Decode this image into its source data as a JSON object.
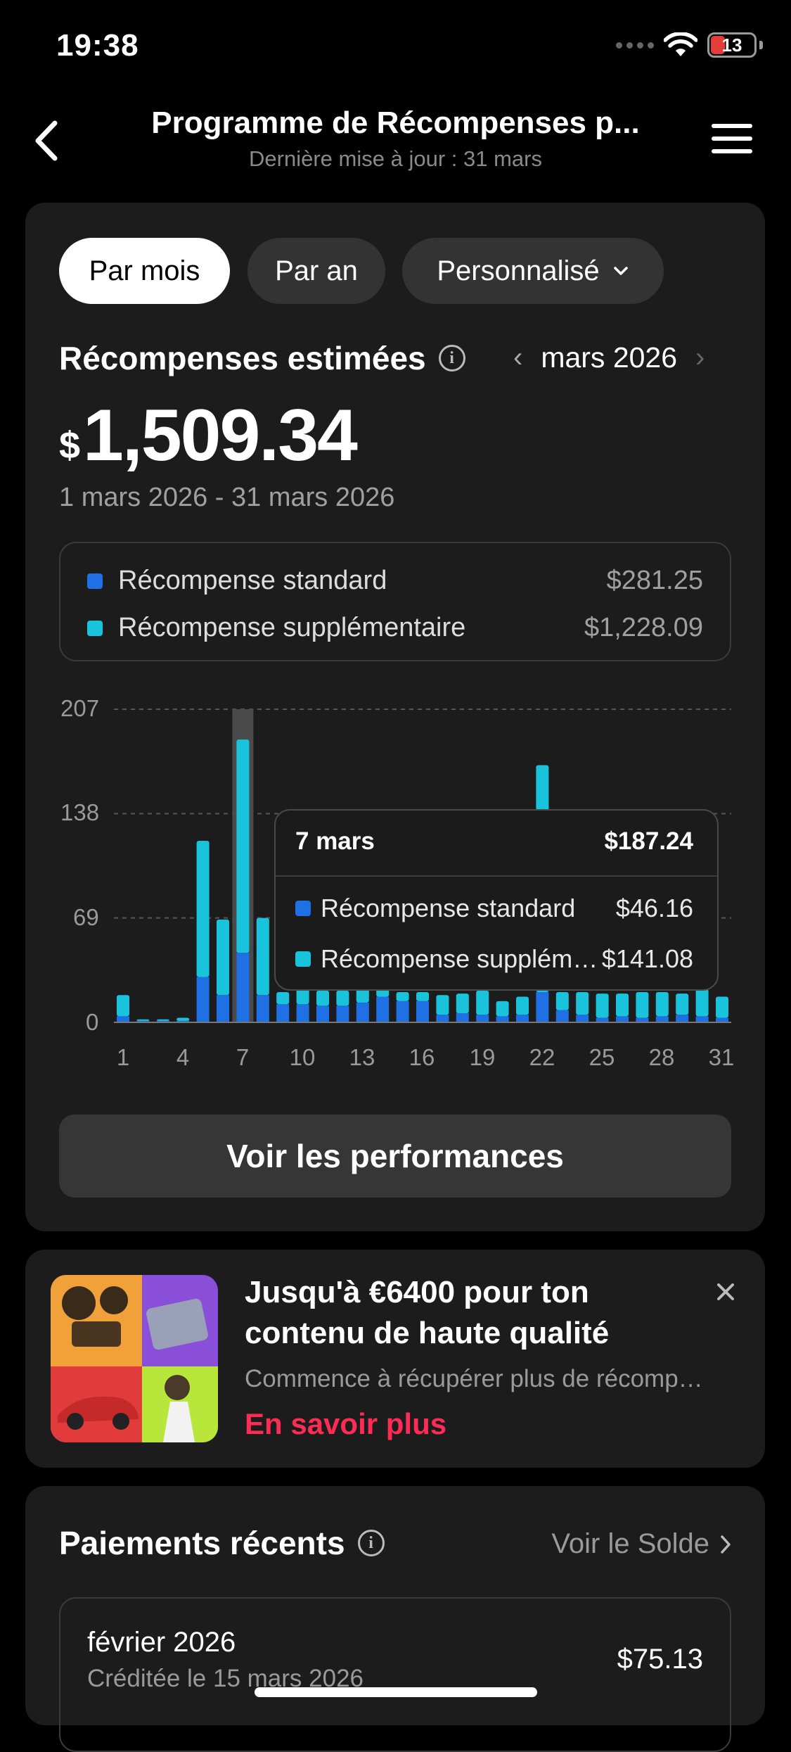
{
  "status_bar": {
    "time": "19:38",
    "battery": "13"
  },
  "header": {
    "title": "Programme de Récompenses p...",
    "subtitle": "Dernière mise à jour : 31 mars"
  },
  "filters": [
    {
      "label": "Par mois",
      "active": true
    },
    {
      "label": "Par an",
      "active": false
    },
    {
      "label": "Personnalisé",
      "active": false
    }
  ],
  "rewards": {
    "title": "Récompenses estimées",
    "month": "mars 2026",
    "currency": "$",
    "amount": "1,509.34",
    "range": "1 mars 2026 - 31 mars 2026",
    "legend": [
      {
        "label": "Récompense standard",
        "value": "$281.25",
        "color": "#1f6fe5"
      },
      {
        "label": "Récompense supplémentaire",
        "value": "$1,228.09",
        "color": "#19c3dc"
      }
    ]
  },
  "chart_data": {
    "type": "bar",
    "stacked": true,
    "x": [
      1,
      2,
      3,
      4,
      5,
      6,
      7,
      8,
      9,
      10,
      11,
      12,
      13,
      14,
      15,
      16,
      17,
      18,
      19,
      20,
      21,
      22,
      23,
      24,
      25,
      26,
      27,
      28,
      29,
      30,
      31
    ],
    "x_ticks": [
      "1",
      "4",
      "7",
      "10",
      "13",
      "16",
      "19",
      "22",
      "25",
      "28",
      "31"
    ],
    "y_ticks": [
      "207",
      "138",
      "69",
      "0"
    ],
    "ylim": [
      0,
      207
    ],
    "highlight_x": 7,
    "grid": true,
    "series": [
      {
        "name": "Récompense standard",
        "color": "#1f6fe5",
        "values": [
          4,
          1,
          1,
          1,
          30,
          18,
          46,
          18,
          12,
          12,
          11,
          11,
          13,
          17,
          14,
          14,
          5,
          6,
          5,
          4,
          5,
          20,
          8,
          5,
          3,
          4,
          3,
          4,
          5,
          4,
          3
        ]
      },
      {
        "name": "Récompense supplémentaire",
        "color": "#19c3dc",
        "values": [
          14,
          1,
          1,
          2,
          90,
          50,
          141,
          51,
          8,
          10,
          10,
          10,
          10,
          5,
          6,
          6,
          13,
          13,
          16,
          10,
          12,
          150,
          12,
          15,
          16,
          15,
          17,
          16,
          14,
          18,
          14
        ]
      }
    ]
  },
  "tooltip": {
    "date": "7 mars",
    "total": "$187.24",
    "rows": [
      {
        "label": "Récompense standard",
        "value": "$46.16",
        "color": "#1f6fe5"
      },
      {
        "label": "Récompense supplémentaire",
        "value": "$141.08",
        "color": "#19c3dc"
      }
    ]
  },
  "performance_button": "Voir les performances",
  "promo": {
    "title": "Jusqu'à €6400 pour ton contenu de haute qualité",
    "subtitle": "Commence à récupérer plus de récompenses",
    "link": "En savoir plus"
  },
  "payments": {
    "title": "Paiements récents",
    "see_balance": "Voir le Solde",
    "items": [
      {
        "month": "février 2026",
        "credited": "Créditée le 15 mars 2026",
        "amount": "$75.13"
      }
    ]
  }
}
